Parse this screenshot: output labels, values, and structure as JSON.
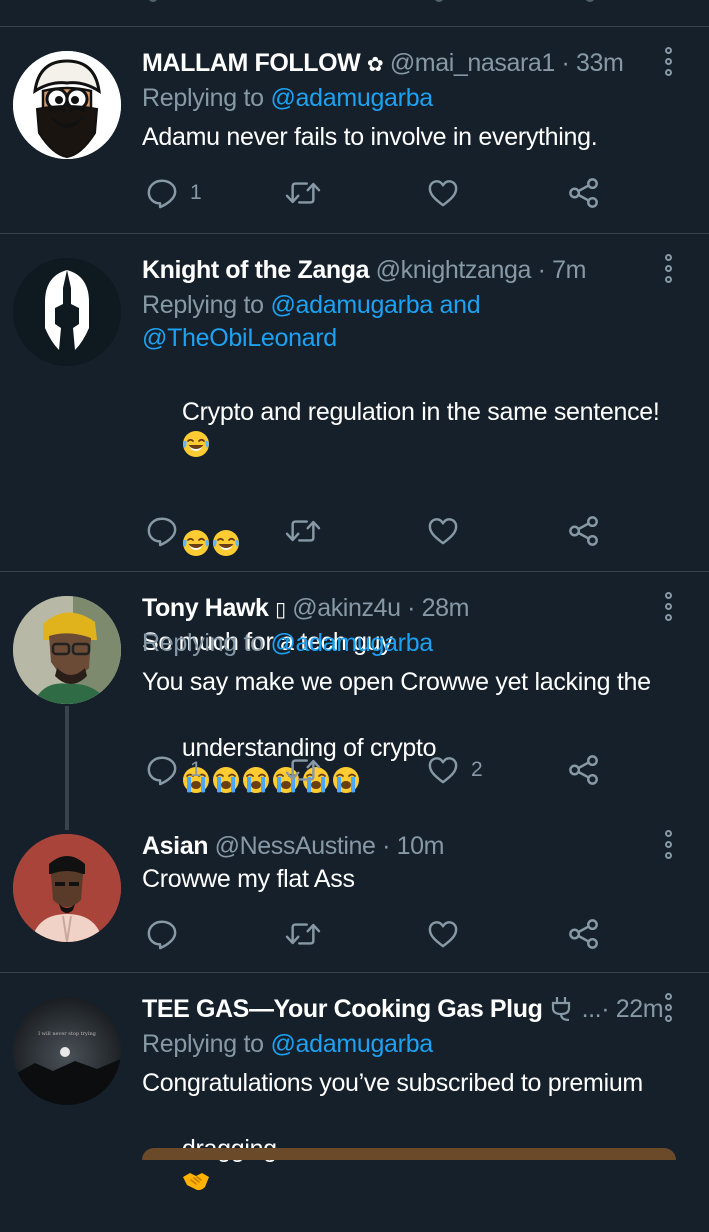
{
  "tweets": [
    {
      "name": "MALLAM FOLLOW",
      "badge": "✿",
      "handle": "@mai_nasara1",
      "time": "· 33m",
      "replying_prefix": "Replying to",
      "mentions": "@adamugarba",
      "text": "Adamu never fails to involve in everything.",
      "replies": "1",
      "retweets": "",
      "likes": ""
    },
    {
      "name": "Knight of the Zanga",
      "handle": "@knightzanga",
      "time": "· 7m",
      "replying_prefix": "Replying to",
      "mentions_line1": "@adamugarba and",
      "mentions_line2": "@TheObiLeonard",
      "text_line1": "Crypto and regulation in the same sentence!",
      "text_line3": "So much for a tech guy",
      "emoji_icon": "face-with-tears-of-joy-icon",
      "replies": "",
      "retweets": "",
      "likes": ""
    },
    {
      "name": "Tony Hawk",
      "badge": "▯",
      "handle": "@akinz4u",
      "time": "· 28m",
      "replying_prefix": "Replying to",
      "mentions": "@adamugarba",
      "text_line1": "You say make we open Crowwe yet lacking the",
      "text_line2": "understanding of crypto",
      "emoji_icon": "loudly-crying-face-icon",
      "replies": "1",
      "retweets": "",
      "likes": "2"
    },
    {
      "name": "Asian",
      "handle": "@NessAustine",
      "time": "· 10m",
      "text": "Crowwe my flat Ass",
      "replies": "",
      "retweets": "",
      "likes": ""
    },
    {
      "name": "TEE GAS—Your Cooking Gas Plug",
      "badge_icon": "plug-icon",
      "handle": "...",
      "time": "· 22m",
      "replying_prefix": "Replying to",
      "mentions": "@adamugarba",
      "text_line1": "Congratulations you’ve subscribed to premium",
      "text_line2": "dragging",
      "emoji_icon": "handshake-icon",
      "avatar_caption": "I will never stop trying"
    }
  ],
  "colors": {
    "background": "#15202b",
    "divider": "#38444d",
    "secondary_text": "#8899a6",
    "link": "#1da1f2",
    "primary_text": "#ffffff"
  }
}
